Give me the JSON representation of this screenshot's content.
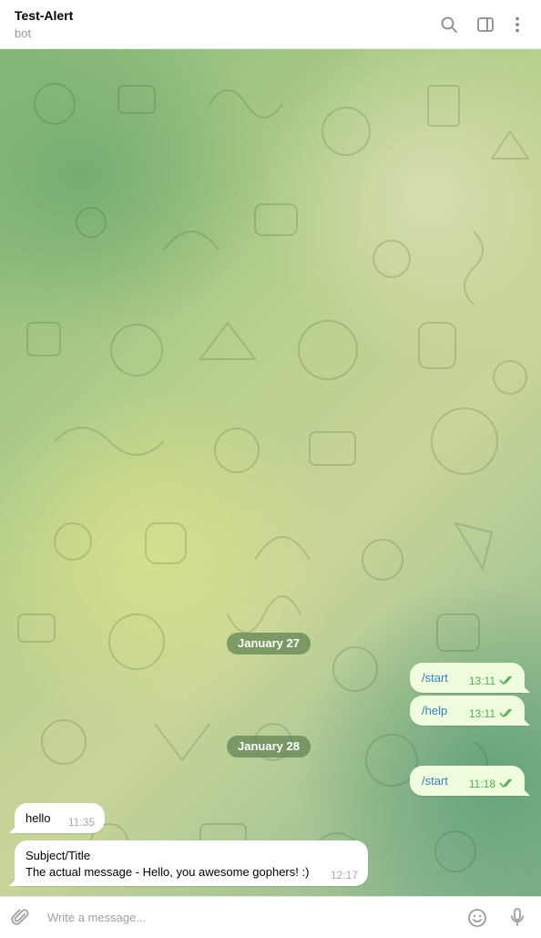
{
  "header": {
    "title": "Test-Alert",
    "subtitle": "bot",
    "icons": [
      "search-icon",
      "sidebar-toggle-icon",
      "more-vertical-icon"
    ]
  },
  "messages": {
    "dates": [
      "January 27",
      "January 28"
    ],
    "outgoing": [
      {
        "text": "/start",
        "time": "13:11"
      },
      {
        "text": "/help",
        "time": "13:11"
      },
      {
        "text": "/start",
        "time": "11:18"
      }
    ],
    "incoming": [
      {
        "text": "hello",
        "time": "11:35"
      },
      {
        "line1": "Subject/Title",
        "line2": "The actual message - Hello, you awesome gophers! :)",
        "time": "12:17"
      }
    ]
  },
  "composer": {
    "placeholder": "Write a message...",
    "icons": [
      "attach-icon",
      "emoji-icon",
      "microphone-icon"
    ]
  },
  "colors": {
    "outgoing_bubble": "#effdde",
    "incoming_bubble": "#ffffff",
    "link": "#3a7bc8",
    "read_checks": "#4fae4e"
  }
}
